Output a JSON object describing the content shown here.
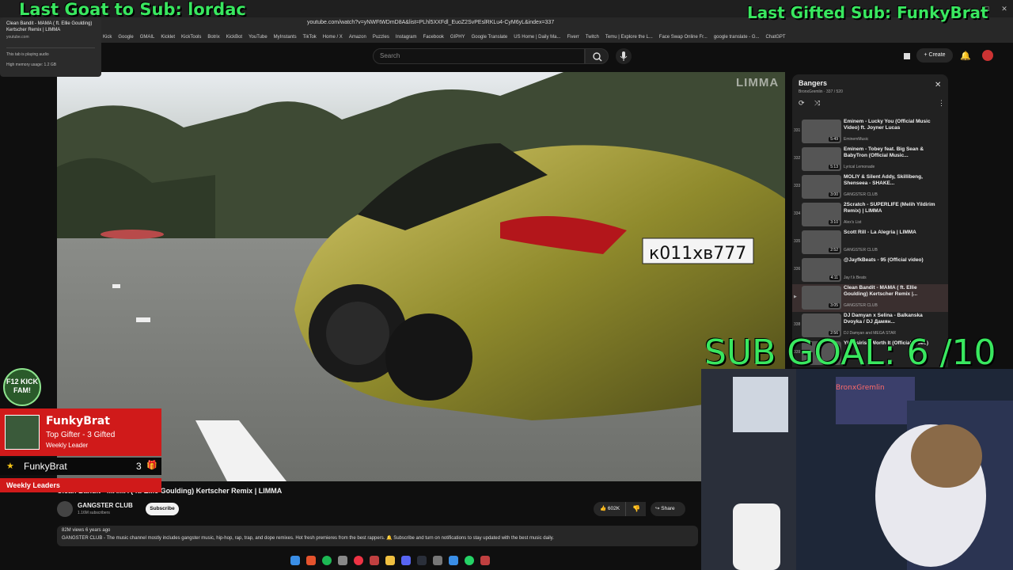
{
  "browser": {
    "url": "youtube.com/watch?v=yNWFtWDmD8A&list=PLhl5XXFdl_EuoZ2SvPEslRKLu4-CyM6yL&index=337",
    "bookmarks": [
      "Kick",
      "Google",
      "GMAIL",
      "Kicklet",
      "KickTools",
      "Botrix",
      "KickBot",
      "YouTube",
      "MyInstants",
      "TikTok",
      "Home / X",
      "Amazon",
      "Puzzles",
      "Instagram",
      "Facebook",
      "GIPHY",
      "Google Translate",
      "US Home | Daily Ma...",
      "Fiverr",
      "Twitch",
      "Temu | Explore the L...",
      "Face Swap Online Fr...",
      "google translate - G...",
      "ChatGPT"
    ],
    "tab_hover": {
      "title": "Clean Bandit - MAMA ( ft. Ellie Goulding) Kertscher Remix | LIMMA",
      "domain": "youtube.com",
      "status_audio": "This tab is playing audio",
      "status_memory": "High memory usage: 1.2 GB"
    }
  },
  "overlays": {
    "last_goat": "Last Goat to Sub: lordac",
    "last_gifted": "Last Gifted Sub: FunkyBrat",
    "sub_goal": "SUB GOAL: 6 /10",
    "gifter_name": "FunkyBrat",
    "gifter_line": "Top Gifter - 3 Gifted",
    "gifter_sub": "Weekly Leader",
    "leader_name": "FunkyBrat",
    "leader_count": "3",
    "weekly_leaders": "Weekly Leaders",
    "f12_logo": "F12 KICK FAM!"
  },
  "youtube": {
    "search_placeholder": "Search",
    "create_label": "Create",
    "watermark": "LIMMA",
    "video_title": "Clean Bandit - MAMA ( ft. Ellie Goulding) Kertscher Remix | LIMMA",
    "channel_name": "GANGSTER CLUB",
    "channel_subs": "1.16M subscribers",
    "subscribe_label": "Subscribe",
    "likes": "602K",
    "share_label": "Share",
    "desc_meta": "82M views  6 years ago",
    "desc_text": "GANGSTER CLUB - The music channel mostly includes gangster music, hip-hop, rap, trap, and dope remixes. Hot fresh premieres from the best rappers. 🔔 Subscribe and turn on notifications to stay updated with the best music daily."
  },
  "playlist": {
    "title": "Bangers",
    "owner": "BronxGremlin · 337 / 520",
    "items": [
      {
        "num": "331",
        "title": "Eminem - Lucky You (Official Music Video) ft. Joyner Lucas",
        "channel": "EminemMusic",
        "duration": "5:49"
      },
      {
        "num": "332",
        "title": "Eminem - Tobey feat. Big Sean & BabyTron (Official Music...",
        "channel": "Lyrical Lemonade",
        "duration": "5:13"
      },
      {
        "num": "333",
        "title": "MOLIY & Silent Addy, Skillibeng, Shenseea - SHAKE...",
        "channel": "GANGSTER CLUB",
        "duration": "3:00"
      },
      {
        "num": "334",
        "title": "2Scratch - SUPERLIFE (Melih Yildirim Remix) | LIMMA",
        "channel": "Alex's List",
        "duration": "3:10"
      },
      {
        "num": "335",
        "title": "Scott Rill - La Alegria | LIMMA",
        "channel": "GANGSTER CLUB",
        "duration": "2:52"
      },
      {
        "num": "336",
        "title": "@JayfkBeats - 95 (Official video)",
        "channel": "Jay f.k Beats",
        "duration": "4:11"
      },
      {
        "num": "▶",
        "title": "Clean Bandit - MAMA ( ft. Ellie Goulding) Kertscher Remix |...",
        "channel": "GANGSTER CLUB",
        "duration": "3:05"
      },
      {
        "num": "338",
        "title": "DJ Damyan x Selina - Balkanska Dvoyka / DJ Дамян...",
        "channel": "DJ Damyan and MEGA STAR",
        "duration": "2:56"
      },
      {
        "num": "339",
        "title": "YK Osiris - Worth It (Official Video)",
        "channel": "",
        "duration": ""
      }
    ]
  }
}
